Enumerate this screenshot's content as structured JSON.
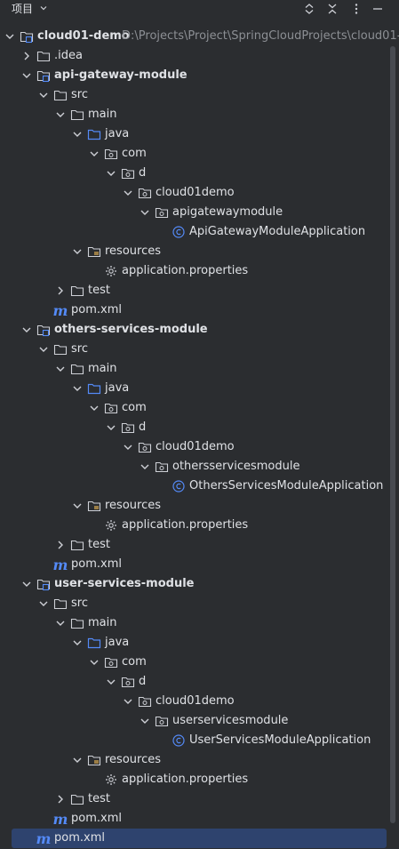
{
  "header": {
    "title": "项目",
    "icons": [
      "chevron-down-icon",
      "expand-collapse-icon",
      "collapse-all-icon",
      "more-options-icon",
      "minimize-icon"
    ]
  },
  "tree": {
    "root": {
      "label": "cloud01-demo",
      "path": "D:\\Projects\\Project\\SpringCloudProjects\\cloud01-"
    },
    "idea": ".idea",
    "api": {
      "module": "api-gateway-module",
      "src": "src",
      "main": "main",
      "java": "java",
      "com": "com",
      "d": "d",
      "pkg": "cloud01demo",
      "subpkg": "apigatewaymodule",
      "app": "ApiGatewayModuleApplication",
      "resources": "resources",
      "props": "application.properties",
      "test": "test",
      "pom": "pom.xml"
    },
    "others": {
      "module": "others-services-module",
      "src": "src",
      "main": "main",
      "java": "java",
      "com": "com",
      "d": "d",
      "pkg": "cloud01demo",
      "subpkg": "othersservicesmodule",
      "app": "OthersServicesModuleApplication",
      "resources": "resources",
      "props": "application.properties",
      "test": "test",
      "pom": "pom.xml"
    },
    "user": {
      "module": "user-services-module",
      "src": "src",
      "main": "main",
      "java": "java",
      "com": "com",
      "d": "d",
      "pkg": "cloud01demo",
      "subpkg": "userservicesmodule",
      "app": "UserServicesModuleApplication",
      "resources": "resources",
      "props": "application.properties",
      "test": "test",
      "pom": "pom.xml"
    },
    "root_pom": "pom.xml"
  },
  "colors": {
    "background": "#2b2d30",
    "selection": "#2e436e",
    "folder": "#c9ccd6",
    "source_folder": "#548af7",
    "class": "#548af7",
    "maven": "#548af7"
  }
}
